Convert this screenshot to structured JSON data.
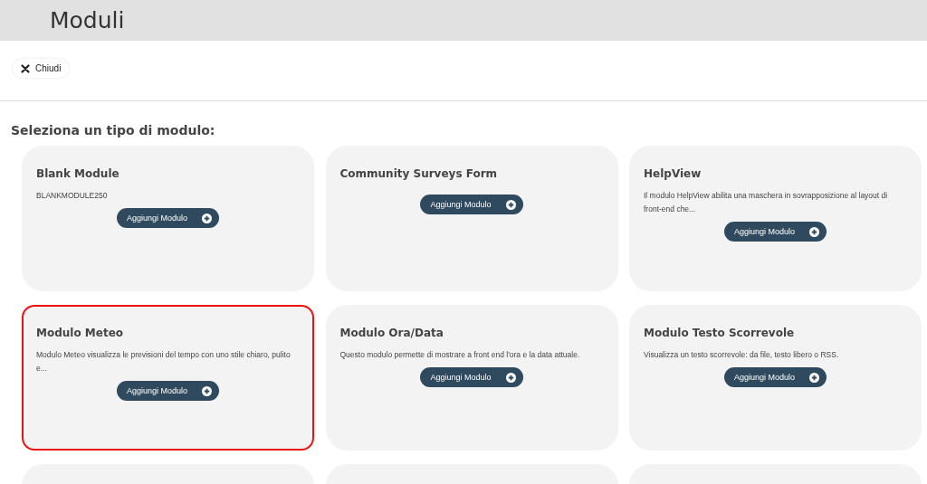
{
  "header": {
    "title": "Moduli"
  },
  "close_button": {
    "label": "Chiudi"
  },
  "section_title": "Seleziona un tipo di modulo:",
  "modules": [
    {
      "title": "Blank Module",
      "description": "BLANKMODULE250",
      "button": "Aggiungi Modulo",
      "highlighted": false
    },
    {
      "title": "Community Surveys Form",
      "button": "Aggiungi Modulo",
      "highlighted": false
    },
    {
      "title": "HelpView",
      "description": "Il modulo HelpView abilita una maschera in sovrapposizione al layout di front-end che...",
      "button": "Aggiungi Modulo",
      "highlighted": false
    },
    {
      "title": "Modulo Meteo",
      "description": "Modulo Meteo visualizza le previsioni del tempo con uno stile chiaro, pulito e...",
      "button": "Aggiungi Modulo",
      "highlighted": true
    },
    {
      "title": "Modulo Ora/Data",
      "description": "Questo modulo permette di mostrare a front end l'ora e la data attuale.",
      "button": "Aggiungi Modulo",
      "highlighted": false
    },
    {
      "title": "Modulo Testo Scorrevole",
      "description": "Visualizza un testo scorrevole: da file, testo libero o RSS.",
      "button": "Aggiungi Modulo",
      "highlighted": false
    },
    {
      "highlighted": false
    },
    {
      "highlighted": false
    },
    {
      "highlighted": false
    }
  ]
}
